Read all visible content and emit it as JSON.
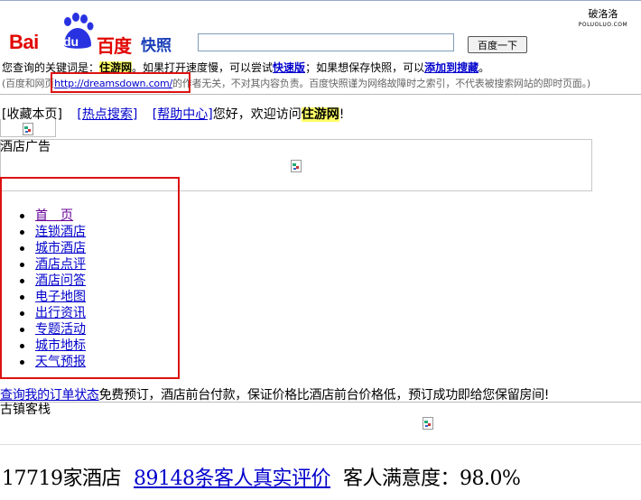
{
  "brand": {
    "logo_bai": "Bai",
    "logo_du": "du",
    "logo_cn": "百度",
    "snapshot_label": "快照",
    "red": "#e10600",
    "blue": "#1a3fb8"
  },
  "search": {
    "value": "",
    "button_label": "百度一下"
  },
  "watermark": {
    "title": "破洛洛",
    "sub": "POLUOLUO.COM"
  },
  "notice": {
    "prefix": "您查询的关键词是：",
    "keyword": "住游网",
    "mid1": "。如果打开速度慢，可以尝试",
    "fast_link": "快速版",
    "mid2": "；如果想保存快照，可以",
    "save_link": "添加到搜藏",
    "end": "。",
    "disclaimer_prefix": "(百度和网页",
    "disclaimer_url": "http://dreamsdown.com/",
    "disclaimer_suffix": "的作者无关，不对其内容负责。百度快照谨为网络故障时之索引，不代表被搜索网站的即时页面。)"
  },
  "topnav": {
    "bookmark": "[收藏本页]",
    "hot_search": "[热点搜索]",
    "help": "[帮助中心]",
    "welcome": "您好，欢迎访问",
    "site_name": "住游网",
    "bang": "!"
  },
  "ad": {
    "label": "酒店广告"
  },
  "nav": {
    "items": [
      "首　页",
      "连锁酒店",
      "城市酒店",
      "酒店点评",
      "酒店问答",
      "电子地图",
      "出行资讯",
      "专题活动",
      "城市地标",
      "天气预报"
    ]
  },
  "order": {
    "link": "查询我的订单状态",
    "text": "免费预订，酒店前台付款，保证价格比酒店前台价格低，预订成功即给您保留房间!"
  },
  "inn": {
    "label": "古镇客栈"
  },
  "stats": {
    "hotels": "17719家酒店",
    "reviews": "89148条客人真实评价",
    "satisfaction": "客人满意度：98.0%"
  }
}
